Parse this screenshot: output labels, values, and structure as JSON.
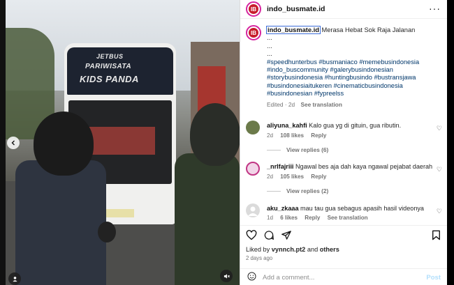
{
  "post": {
    "username": "indo_busmate.id",
    "more_label": "···",
    "caption_user": "indo_busmate.id",
    "caption_text": "Merasa Hebat Sok Raja Jalanan",
    "caption_dots": [
      "...",
      "...",
      "..."
    ],
    "hashtags": "#speedhunterbus #busmaniaco #memebusindonesia #indo_buscommunity #galerybusindonesian #storybusindonesia #huntingbusindo #bustransjawa #busindonesiaitukeren #cinematicbusindonesia #busindonesian #fypreelss",
    "edited_label": "Edited · 2d",
    "translation_label": "See translation"
  },
  "media": {
    "bus_brand": "JETBUS",
    "bus_name": "PARIWISATA",
    "bus_livery": "KIDS PANDA",
    "prev_icon": "chevron-left-icon",
    "user_icon": "person-icon",
    "mute_icon": "mute-icon"
  },
  "comments": [
    {
      "user": "aliyuna_kahfi",
      "text": "Kalo gua yg di gituin, gua ributin.",
      "time": "2d",
      "likes": "108 likes",
      "reply": "Reply",
      "replies": "View replies (6)"
    },
    {
      "user": "_nrlfajriii",
      "text": "Ngawal bes aja dah kaya ngawal pejabat daerah",
      "time": "2d",
      "likes": "105 likes",
      "reply": "Reply",
      "replies": "View replies (2)"
    },
    {
      "user": "aku_zkaaa",
      "text": "mau tau gua sebagus apasih hasil videonya",
      "time": "1d",
      "likes": "6 likes",
      "reply": "Reply",
      "translation": "See translation"
    }
  ],
  "footer": {
    "liked_prefix": "Liked by",
    "liked_user": "vynnch.pt2",
    "liked_mid": "and",
    "liked_others": "others",
    "ago": "2 days ago",
    "add_comment_placeholder": "Add a comment...",
    "post_label": "Post"
  },
  "colors": {
    "link": "#00376b",
    "accent_ring": "#d6249f",
    "post_disabled": "#b2dffc"
  }
}
